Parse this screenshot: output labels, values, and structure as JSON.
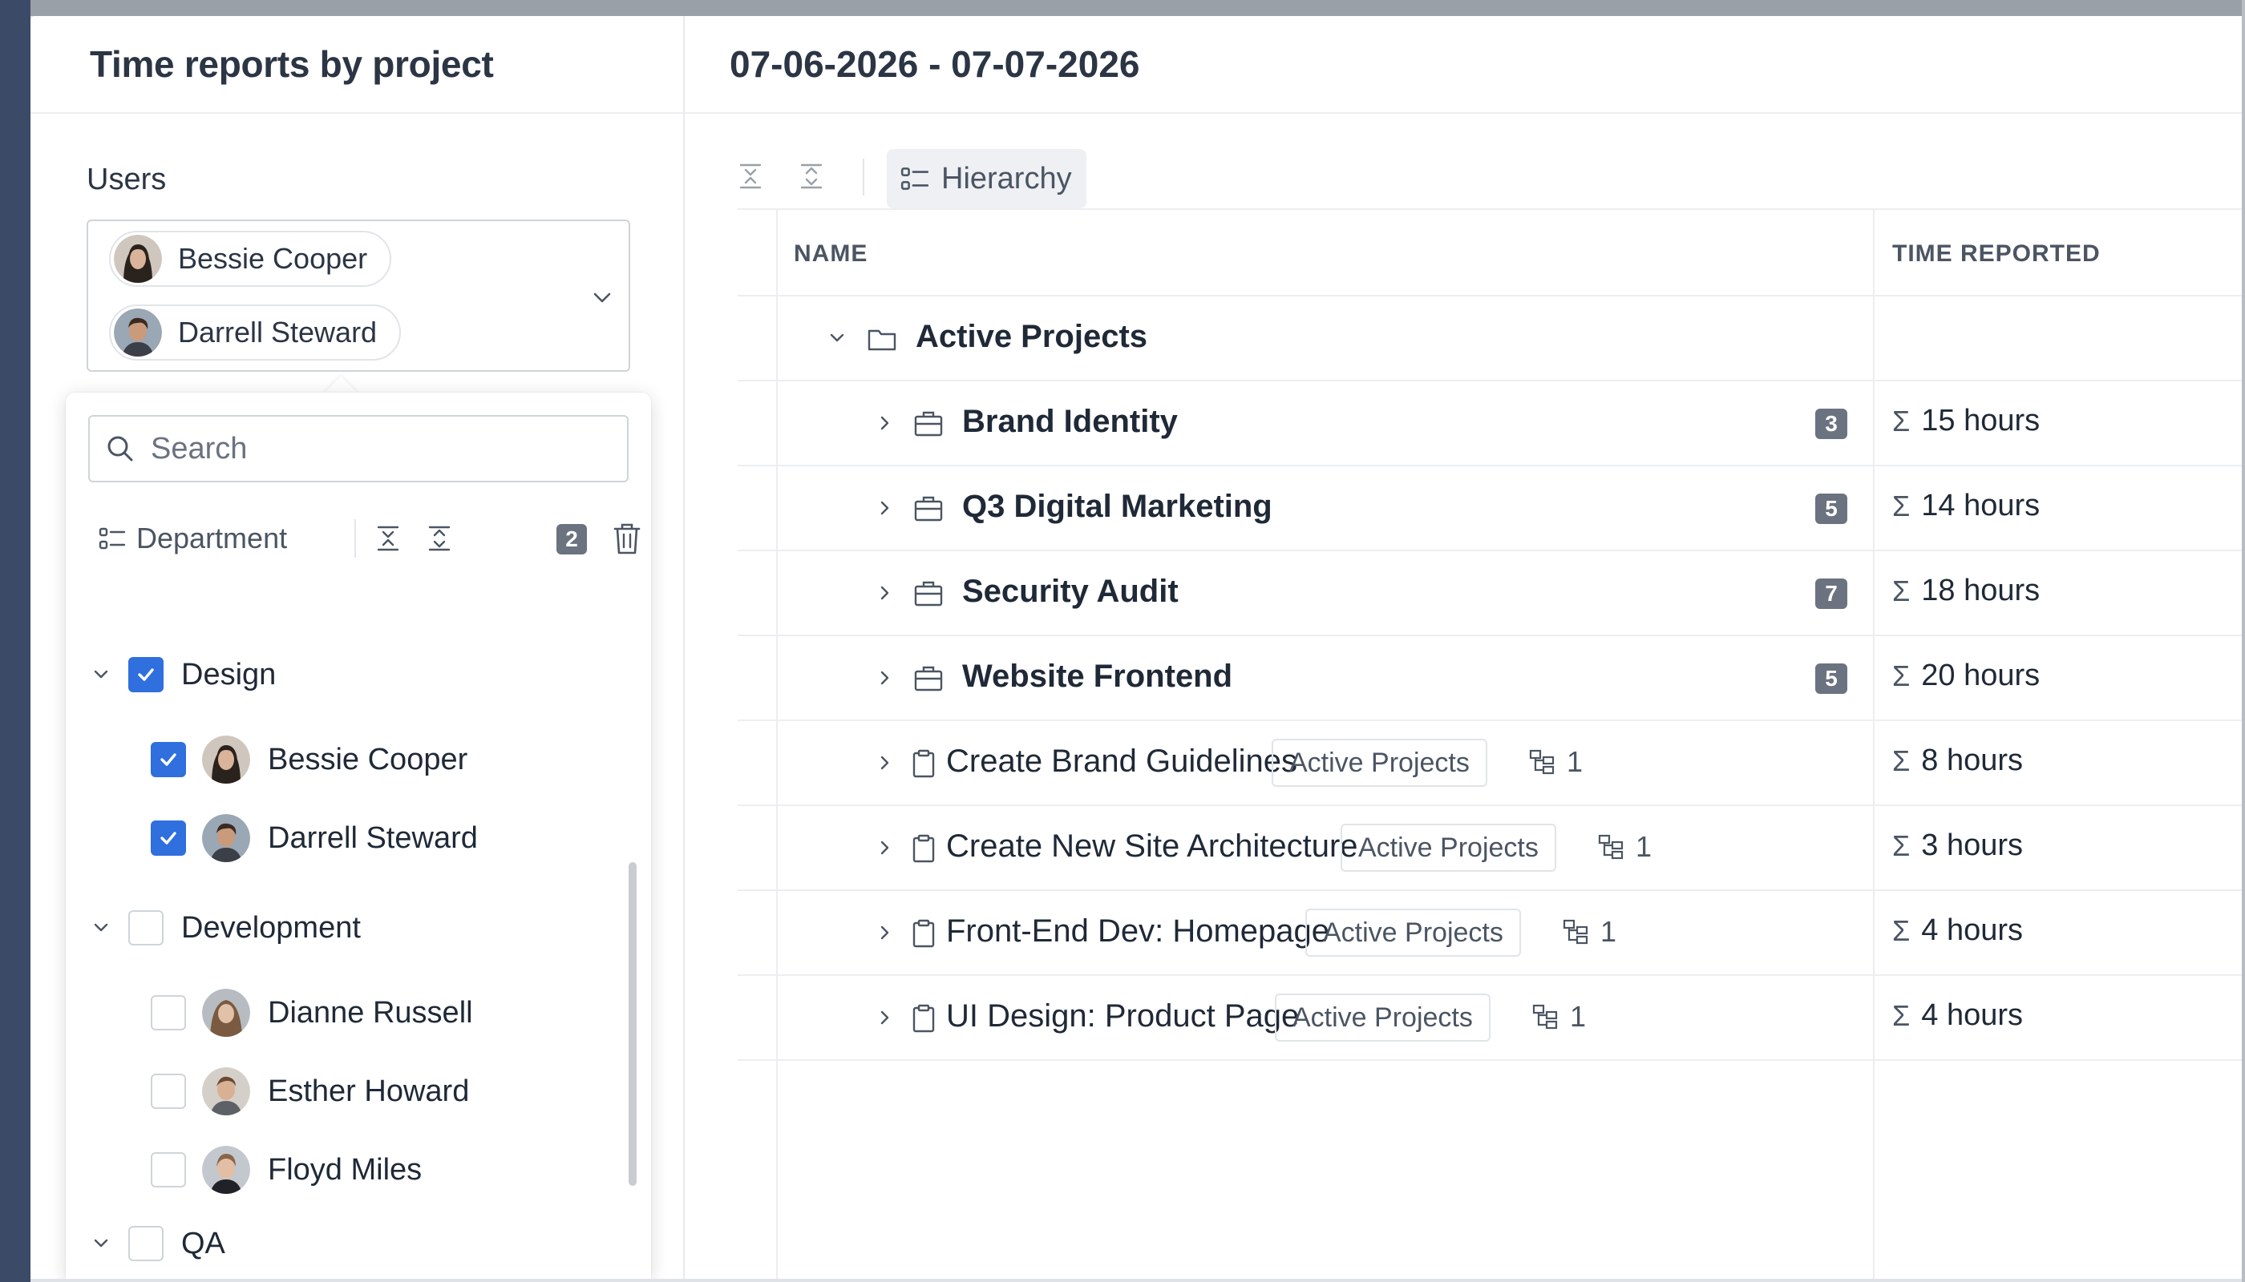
{
  "left_panel": {
    "title": "Time reports by project",
    "users_label": "Users",
    "selected_users": [
      {
        "name": "Bessie Cooper"
      },
      {
        "name": "Darrell Steward"
      }
    ],
    "search": {
      "placeholder": "Search",
      "value": ""
    },
    "toolbar": {
      "group_by_label": "Department",
      "selected_count": "2"
    },
    "groups": [
      {
        "label": "Design",
        "checked": true,
        "users": [
          {
            "name": "Bessie Cooper",
            "checked": true
          },
          {
            "name": "Darrell Steward",
            "checked": true
          }
        ]
      },
      {
        "label": "Development",
        "checked": false,
        "users": [
          {
            "name": "Dianne Russell",
            "checked": false
          },
          {
            "name": "Esther Howard",
            "checked": false
          },
          {
            "name": "Floyd Miles",
            "checked": false
          }
        ]
      },
      {
        "label": "QA",
        "checked": false,
        "users": []
      }
    ]
  },
  "right_panel": {
    "date_range": "07-06-2026 - 07-07-2026",
    "toolbar": {
      "hierarchy_label": "Hierarchy"
    },
    "columns": {
      "name": "NAME",
      "time": "TIME REPORTED"
    },
    "rows": [
      {
        "type": "folder",
        "name": "Active Projects",
        "time": ""
      },
      {
        "type": "project",
        "name": "Brand Identity",
        "badge": "3",
        "time": "15 hours"
      },
      {
        "type": "project",
        "name": "Q3 Digital Marketing",
        "badge": "5",
        "time": "14 hours"
      },
      {
        "type": "project",
        "name": "Security Audit",
        "badge": "7",
        "time": "18 hours"
      },
      {
        "type": "project",
        "name": "Website Frontend",
        "badge": "5",
        "time": "20 hours"
      },
      {
        "type": "task",
        "name": "Create Brand Guidelines",
        "tag": "Active Projects",
        "subtasks": "1",
        "time": "8 hours"
      },
      {
        "type": "task",
        "name": "Create New Site Architecture",
        "tag": "Active Projects",
        "subtasks": "1",
        "time": "3 hours"
      },
      {
        "type": "task",
        "name": "Front-End Dev: Homepage",
        "tag": "Active Projects",
        "subtasks": "1",
        "time": "4 hours"
      },
      {
        "type": "task",
        "name": "UI Design: Product Page",
        "tag": "Active Projects",
        "subtasks": "1",
        "time": "4 hours"
      }
    ]
  },
  "colors": {
    "accent": "#2f6fde",
    "badge": "#6b7280",
    "border": "#eceef1",
    "text": "#1f2937"
  }
}
